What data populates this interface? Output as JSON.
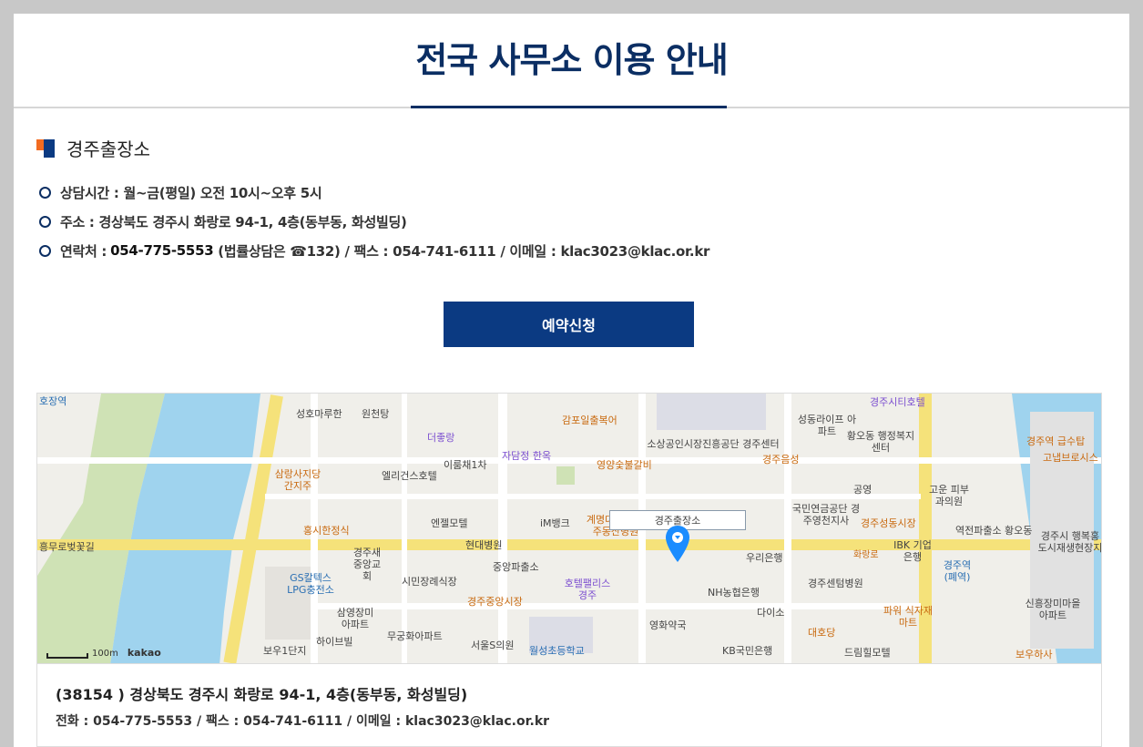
{
  "page": {
    "title": "전국 사무소 이용 안내"
  },
  "office": {
    "name": "경주출장소",
    "hours_label": "상담시간 : 월~금(평일) 오전 10시~오후 5시",
    "address_label": "주소 : 경상북도 경주시 화랑로 94-1, 4층(동부동, 화성빌딩)",
    "contact_prefix": "연락처 : ",
    "contact_phone": "054-775-5553",
    "contact_rest": " (법률상담은 ☎132) / 팩스 : 054-741-6111 / 이메일 : klac3023@klac.or.kr"
  },
  "reserve_button": "예약신청",
  "map": {
    "marker_label": "경주출장소",
    "scale_label": "100m",
    "brand": "kakao",
    "places": [
      {
        "text": "호장역"
      },
      {
        "text": "성호마루한"
      },
      {
        "text": "원천탕"
      },
      {
        "text": "더좋랑"
      },
      {
        "text": "감포일출복어"
      },
      {
        "text": "소상공인시장진흥공단 경주센터"
      },
      {
        "text": "경주시티호텔"
      },
      {
        "text": "성동라이프 아파트"
      },
      {
        "text": "황오동 행정복지센터"
      },
      {
        "text": "경주역 급수탑"
      },
      {
        "text": "고냅브로시스"
      },
      {
        "text": "자담정 한옥"
      },
      {
        "text": "이룸채1차"
      },
      {
        "text": "영양숯불갈비"
      },
      {
        "text": "경주음성"
      },
      {
        "text": "삼랑사지당 간지주"
      },
      {
        "text": "엘리건스호텔"
      },
      {
        "text": "엔젤모텔"
      },
      {
        "text": "iM뱅크"
      },
      {
        "text": "계명대학교 경주동산병원"
      },
      {
        "text": "국민연금공단 경주영천지사"
      },
      {
        "text": "공영"
      },
      {
        "text": "경주성동시장"
      },
      {
        "text": "고운 피부과의원"
      },
      {
        "text": "홍시한정식"
      },
      {
        "text": "흥무로벚꽃길"
      },
      {
        "text": "현대병원"
      },
      {
        "text": "경주새 중앙교회"
      },
      {
        "text": "역전파출소"
      },
      {
        "text": "황오동"
      },
      {
        "text": "경주시 행복홍 도시재생현장지원"
      },
      {
        "text": "GS칼텍스 LPG충전소"
      },
      {
        "text": "시민장례식장"
      },
      {
        "text": "중앙파출소"
      },
      {
        "text": "호텔팰리스 경주"
      },
      {
        "text": "우리은행"
      },
      {
        "text": "IBK 기업은행"
      },
      {
        "text": "경주역 (폐역)"
      },
      {
        "text": "경주중앙시장"
      },
      {
        "text": "NH농협은행"
      },
      {
        "text": "경주센텀병원"
      },
      {
        "text": "다이소"
      },
      {
        "text": "신흥장미마을 아파트"
      },
      {
        "text": "삼영장미 아파트"
      },
      {
        "text": "하이브빌"
      },
      {
        "text": "무궁화아파트"
      },
      {
        "text": "영화약국"
      },
      {
        "text": "파워 식자재마트"
      },
      {
        "text": "대호당"
      },
      {
        "text": "보우1단지"
      },
      {
        "text": "서울S의원"
      },
      {
        "text": "월성초등학교"
      },
      {
        "text": "KB국민은행"
      },
      {
        "text": "드림힐모텔"
      },
      {
        "text": "보우하사"
      },
      {
        "text": "화랑로"
      }
    ]
  },
  "address_box": {
    "main": "(38154 ) 경상북도 경주시 화랑로 94-1, 4층(동부동, 화성빌딩)",
    "sub": "전화 : 054-775-5553 / 팩스 : 054-741-6111 / 이메일 : klac3023@klac.or.kr"
  }
}
